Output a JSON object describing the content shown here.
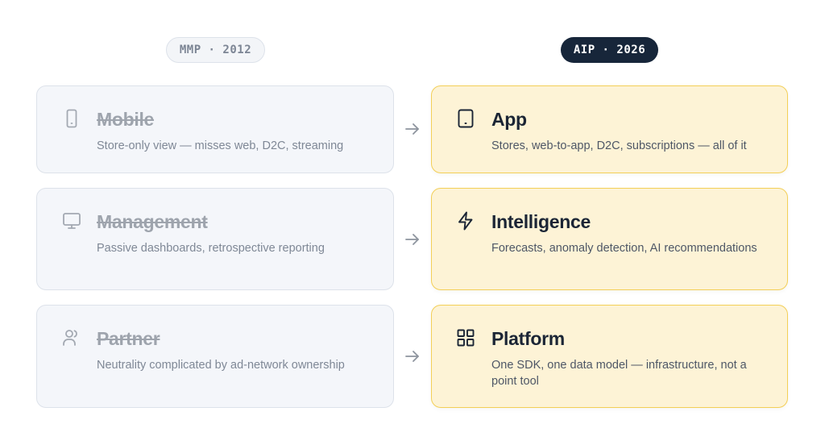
{
  "badges": {
    "old": "MMP · 2012",
    "new": "AIP · 2026"
  },
  "rows": [
    {
      "old": {
        "icon": "smartphone-icon",
        "title": "Mobile",
        "desc": "Store-only view — misses web, D2C, streaming"
      },
      "new": {
        "icon": "tablet-icon",
        "title": "App",
        "desc": "Stores, web-to-app, D2C, subscriptions — all of it"
      }
    },
    {
      "old": {
        "icon": "monitor-icon",
        "title": "Management",
        "desc": "Passive dashboards, retrospective reporting"
      },
      "new": {
        "icon": "lightning-icon",
        "title": "Intelligence",
        "desc": "Forecasts, anomaly detection, AI recommendations"
      }
    },
    {
      "old": {
        "icon": "users-icon",
        "title": "Partner",
        "desc": "Neutrality complicated by ad-network ownership"
      },
      "new": {
        "icon": "grid-icon",
        "title": "Platform",
        "desc": "One SDK, one data model — infrastructure, not a point tool"
      }
    }
  ],
  "colors": {
    "old_card_bg": "#f4f6fa",
    "new_card_bg": "#fdf3d6",
    "new_card_border": "#f3cf57",
    "dark_badge": "#17263a"
  }
}
